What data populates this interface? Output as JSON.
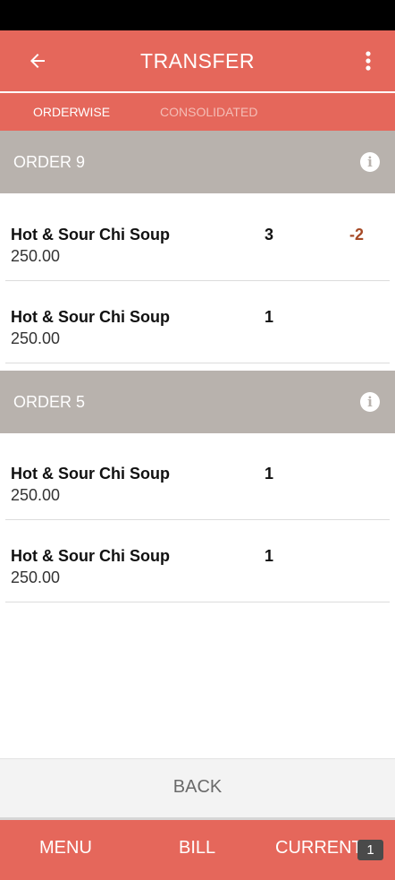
{
  "app_bar": {
    "title": "TRANSFER",
    "back_icon": "arrow-left-icon",
    "menu_icon": "more-vert-icon"
  },
  "tabs": [
    {
      "label": "ORDERWISE",
      "active": true
    },
    {
      "label": "CONSOLIDATED",
      "active": false
    }
  ],
  "orders": [
    {
      "title": "ORDER 9",
      "info_icon": "info-icon",
      "items": [
        {
          "name": "Hot & Sour Chi Soup",
          "price": "250.00",
          "qty": "3",
          "delta": "-2"
        },
        {
          "name": "Hot & Sour Chi Soup",
          "price": "250.00",
          "qty": "1",
          "delta": ""
        }
      ]
    },
    {
      "title": "ORDER 5",
      "info_icon": "info-icon",
      "items": [
        {
          "name": "Hot & Sour Chi Soup",
          "price": "250.00",
          "qty": "1",
          "delta": ""
        },
        {
          "name": "Hot & Sour Chi Soup",
          "price": "250.00",
          "qty": "1",
          "delta": ""
        }
      ]
    }
  ],
  "back_button": {
    "label": "BACK"
  },
  "bottom_nav": {
    "menu_label": "MENU",
    "bill_label": "BILL",
    "current_label": "CURRENT",
    "current_badge": "1"
  },
  "colors": {
    "accent": "#e5675b",
    "order_header": "#b8b2ad",
    "delta_text": "#a64a26"
  }
}
